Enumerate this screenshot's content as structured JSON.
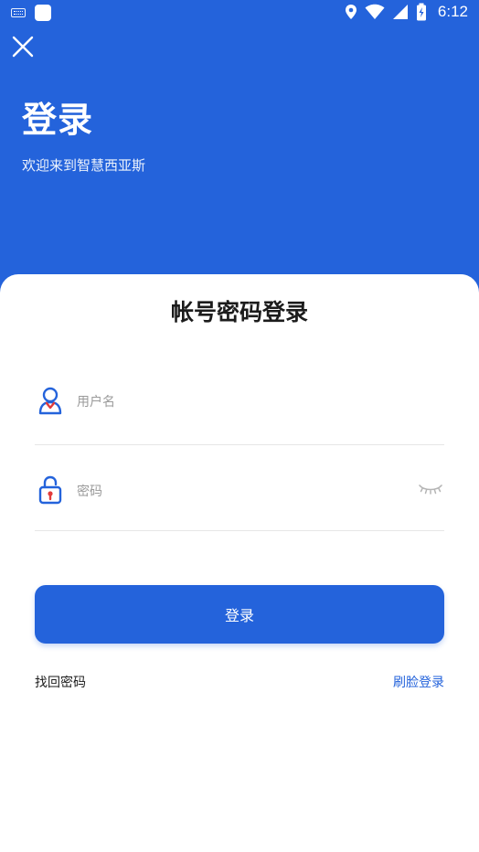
{
  "status_bar": {
    "time": "6:12",
    "icons": [
      "keyboard-icon",
      "app-square-icon",
      "location-icon",
      "wifi-icon",
      "signal-icon",
      "battery-icon"
    ]
  },
  "header": {
    "close_icon": "close-icon",
    "title": "登录",
    "subtitle": "欢迎来到智慧西亚斯",
    "color": "#2463DB"
  },
  "card": {
    "title": "帐号密码登录",
    "username": {
      "placeholder": "用户名",
      "value": "",
      "icon": "user-icon"
    },
    "password": {
      "placeholder": "密码",
      "value": "",
      "icon": "lock-icon",
      "toggle_icon": "eye-closed-icon"
    },
    "submit_label": "登录",
    "forgot_label": "找回密码",
    "face_login_label": "刷脸登录",
    "accent": "#2463DB"
  }
}
